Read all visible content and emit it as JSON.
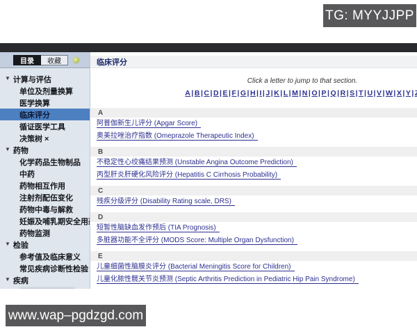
{
  "watermarks": {
    "top": "TG: MYYJJPP",
    "bottom": "www.wap–pgdzgd.com"
  },
  "sidebar": {
    "tabs": [
      {
        "label": "目录",
        "active": true
      },
      {
        "label": "收藏",
        "active": false
      }
    ],
    "groups": [
      {
        "label": "计算与评估",
        "items": [
          {
            "label": "单位及剂量换算",
            "selected": false
          },
          {
            "label": "医学换算",
            "selected": false
          },
          {
            "label": "临床评分",
            "selected": true
          },
          {
            "label": "循证医学工具",
            "selected": false
          },
          {
            "label": "决策树 ×",
            "selected": false
          }
        ]
      },
      {
        "label": "药物",
        "items": [
          {
            "label": "化学药品生物制品",
            "selected": false
          },
          {
            "label": "中药",
            "selected": false
          },
          {
            "label": "药物相互作用",
            "selected": false
          },
          {
            "label": "注射剂配伍变化",
            "selected": false
          },
          {
            "label": "药物中毒与解救",
            "selected": false
          },
          {
            "label": "妊娠及哺乳期安全用药",
            "selected": false
          },
          {
            "label": "药物监测",
            "selected": false
          }
        ]
      },
      {
        "label": "检验",
        "items": [
          {
            "label": "参考值及临床意义",
            "selected": false
          },
          {
            "label": "常见疾病诊断性检验",
            "selected": false
          }
        ]
      },
      {
        "label": "疾病",
        "items": []
      }
    ]
  },
  "content": {
    "title": "临床评分",
    "hint": "Click a letter to jump to that section.",
    "letter_separator": "|",
    "letters": [
      "A",
      "B",
      "C",
      "D",
      "E",
      "F",
      "G",
      "H",
      "I",
      "J",
      "K",
      "L",
      "M",
      "N",
      "O",
      "P",
      "Q",
      "R",
      "S",
      "T",
      "U",
      "V",
      "W",
      "X",
      "Y",
      "Z"
    ],
    "sections": [
      {
        "letter": "A",
        "links": [
          "阿普伽新生儿评分 (Apgar Score)",
          "奥美拉唑治疗指数 (Omeprazole Therapeutic Index)"
        ]
      },
      {
        "letter": "B",
        "links": [
          "不稳定性心绞痛结果预测 (Unstable Angina Outcome Prediction)",
          "丙型肝炎肝硬化风险评分 (Hepatitis C Cirrhosis Probability)"
        ]
      },
      {
        "letter": "C",
        "links": [
          "残疾分级评分 (Disability Rating scale, DRS)"
        ]
      },
      {
        "letter": "D",
        "links": [
          "短暂性脑缺血发作预后 (TIA Prognosis)",
          "多脏器功能不全评分 (MODS Score: Multiple Organ Dysfunction)"
        ]
      },
      {
        "letter": "E",
        "links": [
          "儿童细菌性脑膜炎评分 (Bacterial Meningitis Score for Children)",
          "儿童化脓性髋关节炎预测 (Septic Arthritis Prediction in Pediatric Hip Pain Syndrome)"
        ]
      }
    ]
  },
  "colors": {
    "accent_link": "#2b2f8e",
    "selected_item": "#4c80c1",
    "sidebar_bg": "#e0e6ee",
    "tabbar_bg": "#c3cfdf",
    "dark_bar": "#282a2e",
    "watermark_bg": "#58585a",
    "section_bar_bg": "#efefef"
  }
}
